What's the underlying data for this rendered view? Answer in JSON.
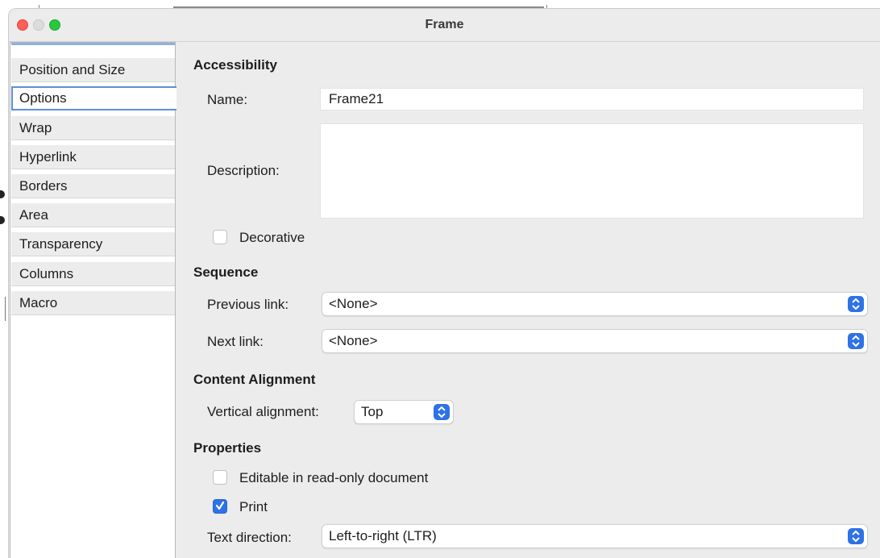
{
  "window": {
    "title": "Frame"
  },
  "sidebar": {
    "items": [
      {
        "label": "Position and Size"
      },
      {
        "label": "Options"
      },
      {
        "label": "Wrap"
      },
      {
        "label": "Hyperlink"
      },
      {
        "label": "Borders"
      },
      {
        "label": "Area"
      },
      {
        "label": "Transparency"
      },
      {
        "label": "Columns"
      },
      {
        "label": "Macro"
      }
    ],
    "active": "Options"
  },
  "accessibility": {
    "heading": "Accessibility",
    "name_label": "Name:",
    "name_value": "Frame21",
    "description_label": "Description:",
    "description_value": "",
    "decorative_label": "Decorative",
    "decorative_checked": false
  },
  "sequence": {
    "heading": "Sequence",
    "previous_label": "Previous link:",
    "previous_value": "<None>",
    "next_label": "Next link:",
    "next_value": "<None>"
  },
  "content_alignment": {
    "heading": "Content Alignment",
    "vertical_label": "Vertical alignment:",
    "vertical_value": "Top"
  },
  "properties": {
    "heading": "Properties",
    "editable_label": "Editable in read-only document",
    "editable_checked": false,
    "print_label": "Print",
    "print_checked": true,
    "text_direction_label": "Text direction:",
    "text_direction_value": "Left-to-right (LTR)"
  },
  "colors": {
    "accent": "#2e72e6",
    "close": "#fe5f57",
    "maximize": "#29c840"
  }
}
